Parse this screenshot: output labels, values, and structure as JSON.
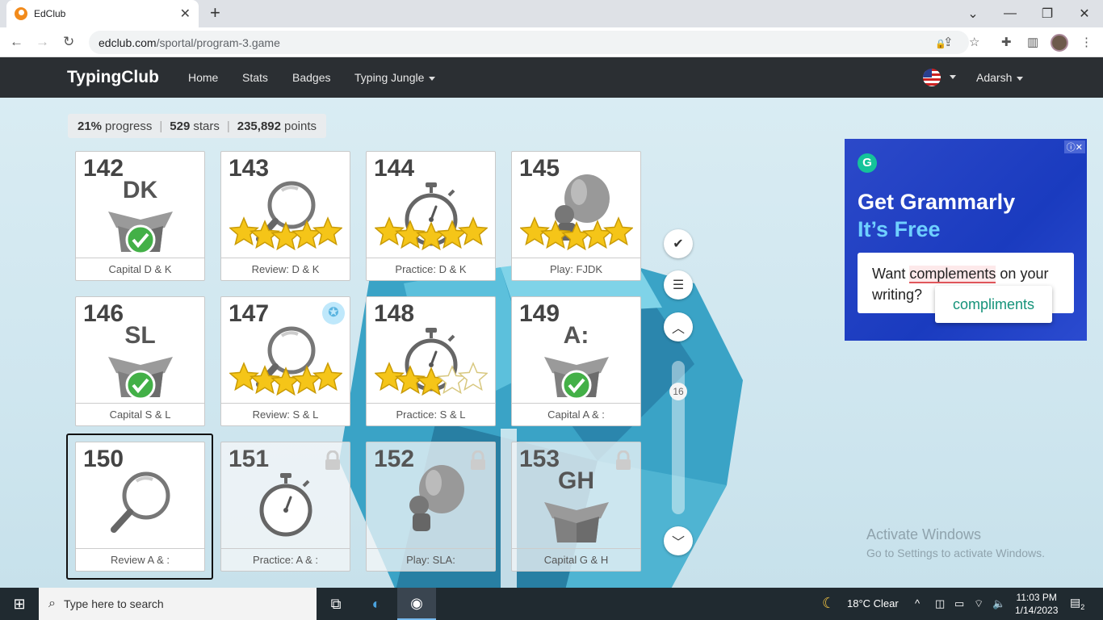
{
  "browser": {
    "tab_title": "EdClub",
    "url_main": "edclub.com",
    "url_path": "/sportal/program-3.game"
  },
  "site": {
    "brand": "TypingClub",
    "nav": {
      "home": "Home",
      "stats": "Stats",
      "badges": "Badges",
      "jungle": "Typing Jungle"
    },
    "user": "Adarsh"
  },
  "stats": {
    "progress_value": "21%",
    "progress_label": "progress",
    "stars_value": "529",
    "stars_label": "stars",
    "points_value": "235,892",
    "points_label": "points"
  },
  "lessons": [
    {
      "num": "142",
      "label": "Capital D & K",
      "letters": "DK",
      "kind": "box-check"
    },
    {
      "num": "143",
      "label": "Review: D & K",
      "kind": "magnifier",
      "stars": 5
    },
    {
      "num": "144",
      "label": "Practice: D & K",
      "kind": "stopwatch",
      "stars": 5
    },
    {
      "num": "145",
      "label": "Play: FJDK",
      "kind": "game",
      "stars": 5
    },
    {
      "num": "146",
      "label": "Capital S & L",
      "letters": "SL",
      "kind": "box-check"
    },
    {
      "num": "147",
      "label": "Review: S & L",
      "kind": "magnifier",
      "stars": 5
    },
    {
      "num": "148",
      "label": "Practice: S & L",
      "kind": "stopwatch",
      "stars": 3
    },
    {
      "num": "149",
      "label": "Capital A & :",
      "letters": "A:",
      "kind": "box-check"
    },
    {
      "num": "150",
      "label": "Review A & :",
      "kind": "magnifier",
      "selected": true
    },
    {
      "num": "151",
      "label": "Practice: A & :",
      "kind": "stopwatch",
      "locked": true
    },
    {
      "num": "152",
      "label": "Play: SLA:",
      "kind": "game",
      "locked": true
    },
    {
      "num": "153",
      "label": "Capital G & H",
      "letters": "GH",
      "kind": "box",
      "locked": true
    }
  ],
  "scroll": {
    "page": "16"
  },
  "ad": {
    "icon_letter": "G",
    "headline1": "Get Grammarly",
    "headline2": "It’s Free",
    "text_before": "Want",
    "text_error": "complements",
    "text_after": "on your writing?",
    "suggestion": "compliments"
  },
  "watermark": {
    "line1": "Activate Windows",
    "line2": "Go to Settings to activate Windows."
  },
  "taskbar": {
    "search_placeholder": "Type here to search",
    "weather": "18°C  Clear",
    "time": "11:03 PM",
    "date": "1/14/2023",
    "notifications": "2"
  }
}
